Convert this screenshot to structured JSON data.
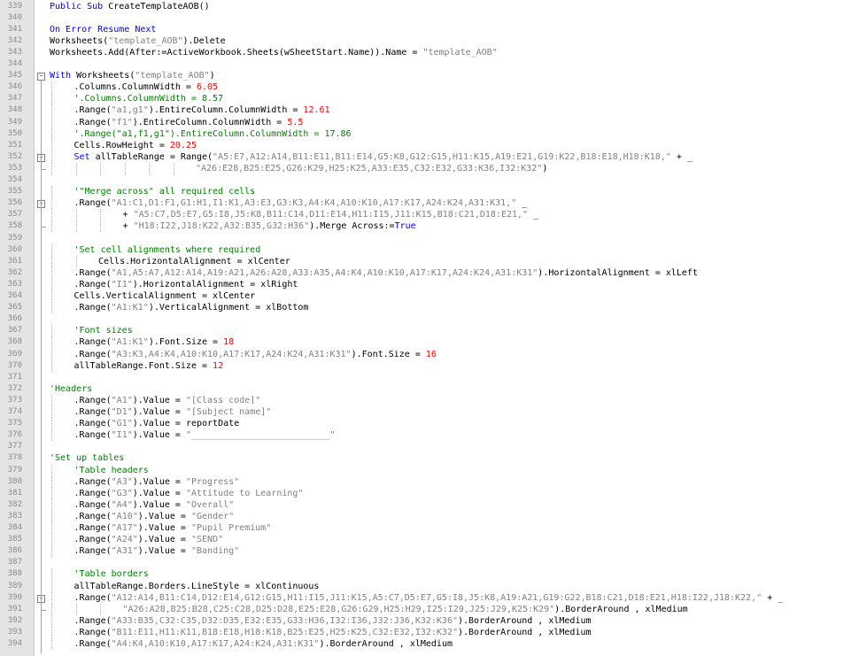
{
  "lines": [
    {
      "n": "339",
      "indent": 0,
      "segs": [
        [
          "kw",
          "Public Sub "
        ],
        [
          "",
          "CreateTemplateAOB()"
        ]
      ]
    },
    {
      "n": "340",
      "indent": 0,
      "segs": []
    },
    {
      "n": "341",
      "indent": 0,
      "segs": [
        [
          "kw",
          "On Error Resume Next"
        ]
      ]
    },
    {
      "n": "342",
      "indent": 0,
      "segs": [
        [
          "",
          "Worksheets("
        ],
        [
          "str",
          "\"template_AOB\""
        ],
        [
          "",
          ").Delete"
        ]
      ]
    },
    {
      "n": "343",
      "indent": 0,
      "segs": [
        [
          "",
          "Worksheets.Add(After:=ActiveWorkbook.Sheets(wSheetStart.Name)).Name = "
        ],
        [
          "str",
          "\"template_AOB\""
        ]
      ]
    },
    {
      "n": "344",
      "indent": 0,
      "segs": []
    },
    {
      "n": "345",
      "indent": 0,
      "fold": "open",
      "segs": [
        [
          "kw",
          "With "
        ],
        [
          "",
          "Worksheets("
        ],
        [
          "str",
          "\"template_AOB\""
        ],
        [
          "",
          ")"
        ]
      ]
    },
    {
      "n": "346",
      "indent": 1,
      "segs": [
        [
          "",
          ".Columns.ColumnWidth = "
        ],
        [
          "num",
          "6.05"
        ]
      ]
    },
    {
      "n": "347",
      "indent": 1,
      "segs": [
        [
          "cm",
          "'.Columns.ColumnWidth = 8.57"
        ]
      ]
    },
    {
      "n": "348",
      "indent": 1,
      "segs": [
        [
          "",
          ".Range("
        ],
        [
          "str",
          "\"a1,g1\""
        ],
        [
          "",
          ").EntireColumn.ColumnWidth = "
        ],
        [
          "num",
          "12.61"
        ]
      ]
    },
    {
      "n": "349",
      "indent": 1,
      "segs": [
        [
          "",
          ".Range("
        ],
        [
          "str",
          "\"f1\""
        ],
        [
          "",
          ").EntireColumn.ColumnWidth = "
        ],
        [
          "num",
          "5.5"
        ]
      ]
    },
    {
      "n": "350",
      "indent": 1,
      "segs": [
        [
          "cm",
          "'.Range(\"a1,f1,g1\").EntireColumn.ColumnWidth = 17.86"
        ]
      ]
    },
    {
      "n": "351",
      "indent": 1,
      "segs": [
        [
          "",
          "Cells.RowHeight = "
        ],
        [
          "num",
          "20.25"
        ]
      ]
    },
    {
      "n": "352",
      "indent": 1,
      "fold": "open",
      "segs": [
        [
          "kw",
          "Set "
        ],
        [
          "",
          "allTableRange = Range("
        ],
        [
          "str",
          "\"A5:E7,A12:A14,B11:E11,B11:E14,G5:K8,G12:G15,H11:K15,A19:E21,G19:K22,B18:E18,H18:K18,\""
        ],
        [
          "",
          " + _"
        ]
      ]
    },
    {
      "n": "353",
      "indent": 6,
      "segs": [
        [
          "str",
          "\"A26:E28,B25:E25,G26:K29,H25:K25,A33:E35,C32:E32,G33:K36,I32:K32\""
        ],
        [
          "",
          ")"
        ]
      ]
    },
    {
      "n": "354",
      "indent": 0,
      "segs": []
    },
    {
      "n": "355",
      "indent": 1,
      "segs": [
        [
          "cm",
          "'\"Merge across\" all required cells"
        ]
      ]
    },
    {
      "n": "356",
      "indent": 1,
      "fold": "open",
      "segs": [
        [
          "",
          ".Range("
        ],
        [
          "str",
          "\"A1:C1,D1:F1,G1:H1,I1:K1,A3:E3,G3:K3,A4:K4,A10:K10,A17:K17,A24:K24,A31:K31,\""
        ],
        [
          "",
          " _"
        ]
      ]
    },
    {
      "n": "357",
      "indent": 3,
      "segs": [
        [
          "",
          "+ "
        ],
        [
          "str",
          "\"A5:C7,D5:E7,G5:I8,J5:K8,B11:C14,D11:E14,H11:I15,J11:K15,B18:C21,D18:E21,\""
        ],
        [
          "",
          " _"
        ]
      ]
    },
    {
      "n": "358",
      "indent": 3,
      "segs": [
        [
          "",
          "+ "
        ],
        [
          "str",
          "\"H18:I22,J18:K22,A32:B35,G32:H36\""
        ],
        [
          "",
          ").Merge Across:="
        ],
        [
          "kw",
          "True"
        ]
      ]
    },
    {
      "n": "359",
      "indent": 0,
      "segs": []
    },
    {
      "n": "360",
      "indent": 1,
      "segs": [
        [
          "cm",
          "'Set cell alignments where required"
        ]
      ]
    },
    {
      "n": "361",
      "indent": 2,
      "segs": [
        [
          "",
          "Cells.HorizontalAlignment = xlCenter"
        ]
      ]
    },
    {
      "n": "362",
      "indent": 1,
      "segs": [
        [
          "",
          ".Range("
        ],
        [
          "str",
          "\"A1,A5:A7,A12:A14,A19:A21,A26:A28,A33:A35,A4:K4,A10:K10,A17:K17,A24:K24,A31:K31\""
        ],
        [
          "",
          ").HorizontalAlignment = xlLeft"
        ]
      ]
    },
    {
      "n": "363",
      "indent": 1,
      "segs": [
        [
          "",
          ".Range("
        ],
        [
          "str",
          "\"I1\""
        ],
        [
          "",
          ").HorizontalAlignment = xlRight"
        ]
      ]
    },
    {
      "n": "364",
      "indent": 1,
      "segs": [
        [
          "",
          "Cells.VerticalAlignment = xlCenter"
        ]
      ]
    },
    {
      "n": "365",
      "indent": 1,
      "segs": [
        [
          "",
          ".Range("
        ],
        [
          "str",
          "\"A1:K1\""
        ],
        [
          "",
          ").VerticalAlignment = xlBottom"
        ]
      ]
    },
    {
      "n": "366",
      "indent": 0,
      "segs": []
    },
    {
      "n": "367",
      "indent": 1,
      "segs": [
        [
          "cm",
          "'Font sizes"
        ]
      ]
    },
    {
      "n": "368",
      "indent": 1,
      "segs": [
        [
          "",
          ".Range("
        ],
        [
          "str",
          "\"A1:K1\""
        ],
        [
          "",
          ").Font.Size = "
        ],
        [
          "num",
          "18"
        ]
      ]
    },
    {
      "n": "369",
      "indent": 1,
      "segs": [
        [
          "",
          ".Range("
        ],
        [
          "str",
          "\"A3:K3,A4:K4,A10:K10,A17:K17,A24:K24,A31:K31\""
        ],
        [
          "",
          ").Font.Size = "
        ],
        [
          "num",
          "16"
        ]
      ]
    },
    {
      "n": "370",
      "indent": 1,
      "segs": [
        [
          "",
          "allTableRange.Font.Size = "
        ],
        [
          "num",
          "12"
        ]
      ]
    },
    {
      "n": "371",
      "indent": 0,
      "segs": []
    },
    {
      "n": "372",
      "indent": 0,
      "segs": [
        [
          "cm",
          "'Headers"
        ]
      ]
    },
    {
      "n": "373",
      "indent": 1,
      "segs": [
        [
          "",
          ".Range("
        ],
        [
          "str",
          "\"A1\""
        ],
        [
          "",
          ").Value = "
        ],
        [
          "str",
          "\"[Class code]\""
        ]
      ]
    },
    {
      "n": "374",
      "indent": 1,
      "segs": [
        [
          "",
          ".Range("
        ],
        [
          "str",
          "\"D1\""
        ],
        [
          "",
          ").Value = "
        ],
        [
          "str",
          "\"[Subject name]\""
        ]
      ]
    },
    {
      "n": "375",
      "indent": 1,
      "segs": [
        [
          "",
          ".Range("
        ],
        [
          "str",
          "\"G1\""
        ],
        [
          "",
          ").Value = reportDate"
        ]
      ]
    },
    {
      "n": "376",
      "indent": 1,
      "segs": [
        [
          "",
          ".Range("
        ],
        [
          "str",
          "\"I1\""
        ],
        [
          "",
          ").Value = "
        ],
        [
          "str",
          "\"__________________________\""
        ]
      ]
    },
    {
      "n": "377",
      "indent": 0,
      "segs": []
    },
    {
      "n": "378",
      "indent": 0,
      "segs": [
        [
          "cm",
          "'Set up tables"
        ]
      ]
    },
    {
      "n": "379",
      "indent": 1,
      "segs": [
        [
          "cm",
          "'Table headers"
        ]
      ]
    },
    {
      "n": "380",
      "indent": 1,
      "segs": [
        [
          "",
          ".Range("
        ],
        [
          "str",
          "\"A3\""
        ],
        [
          "",
          ").Value = "
        ],
        [
          "str",
          "\"Progress\""
        ]
      ]
    },
    {
      "n": "381",
      "indent": 1,
      "segs": [
        [
          "",
          ".Range("
        ],
        [
          "str",
          "\"G3\""
        ],
        [
          "",
          ").Value = "
        ],
        [
          "str",
          "\"Attitude to Learning\""
        ]
      ]
    },
    {
      "n": "382",
      "indent": 1,
      "segs": [
        [
          "",
          ".Range("
        ],
        [
          "str",
          "\"A4\""
        ],
        [
          "",
          ").Value = "
        ],
        [
          "str",
          "\"Overall\""
        ]
      ]
    },
    {
      "n": "383",
      "indent": 1,
      "segs": [
        [
          "",
          ".Range("
        ],
        [
          "str",
          "\"A10\""
        ],
        [
          "",
          ").Value = "
        ],
        [
          "str",
          "\"Gender\""
        ]
      ]
    },
    {
      "n": "384",
      "indent": 1,
      "segs": [
        [
          "",
          ".Range("
        ],
        [
          "str",
          "\"A17\""
        ],
        [
          "",
          ").Value = "
        ],
        [
          "str",
          "\"Pupil Premium\""
        ]
      ]
    },
    {
      "n": "385",
      "indent": 1,
      "segs": [
        [
          "",
          ".Range("
        ],
        [
          "str",
          "\"A24\""
        ],
        [
          "",
          ").Value = "
        ],
        [
          "str",
          "\"SEND\""
        ]
      ]
    },
    {
      "n": "386",
      "indent": 1,
      "segs": [
        [
          "",
          ".Range("
        ],
        [
          "str",
          "\"A31\""
        ],
        [
          "",
          ").Value = "
        ],
        [
          "str",
          "\"Banding\""
        ]
      ]
    },
    {
      "n": "387",
      "indent": 0,
      "segs": []
    },
    {
      "n": "388",
      "indent": 1,
      "segs": [
        [
          "cm",
          "'Table borders"
        ]
      ]
    },
    {
      "n": "389",
      "indent": 1,
      "segs": [
        [
          "",
          "allTableRange.Borders.LineStyle = xlContinuous"
        ]
      ]
    },
    {
      "n": "390",
      "indent": 1,
      "fold": "open",
      "segs": [
        [
          "",
          ".Range("
        ],
        [
          "str",
          "\"A12:A14,B11:C14,D12:E14,G12:G15,H11:I15,J11:K15,A5:C7,D5:E7,G5:I8,J5:K8,A19:A21,G19:G22,B18:C21,D18:E21,H18:I22,J18:K22,\""
        ],
        [
          "",
          " + _"
        ]
      ]
    },
    {
      "n": "391",
      "indent": 3,
      "segs": [
        [
          "str",
          "\"A26:A28,B25:B28,C25:C28,D25:D28,E25:E28,G26:G29,H25:H29,I25:I29,J25:J29,K25:K29\""
        ],
        [
          "",
          ").BorderAround , xlMedium"
        ]
      ]
    },
    {
      "n": "392",
      "indent": 1,
      "segs": [
        [
          "",
          ".Range("
        ],
        [
          "str",
          "\"A33:B35,C32:C35,D32:D35,E32:E35,G33:H36,I32:I36,J32:J36,K32:K36\""
        ],
        [
          "",
          ").BorderAround , xlMedium"
        ]
      ]
    },
    {
      "n": "393",
      "indent": 1,
      "segs": [
        [
          "",
          ".Range("
        ],
        [
          "str",
          "\"B11:E11,H11:K11,B18:E18,H18:K18,B25:E25,H25:K25,C32:E32,I32:K32\""
        ],
        [
          "",
          ").BorderAround , xlMedium"
        ]
      ]
    },
    {
      "n": "394",
      "indent": 1,
      "segs": [
        [
          "",
          ".Range("
        ],
        [
          "str",
          "\"A4:K4,A10:K10,A17:K17,A24:K24,A31:K31\""
        ],
        [
          "",
          ").BorderAround , xlMedium"
        ]
      ]
    }
  ],
  "colors": {
    "keyword": "#0000ff",
    "string": "#808080",
    "number": "#ff0000",
    "comment": "#008000",
    "gutter": "#e4e4e4",
    "line_number": "#8a8a8a"
  }
}
